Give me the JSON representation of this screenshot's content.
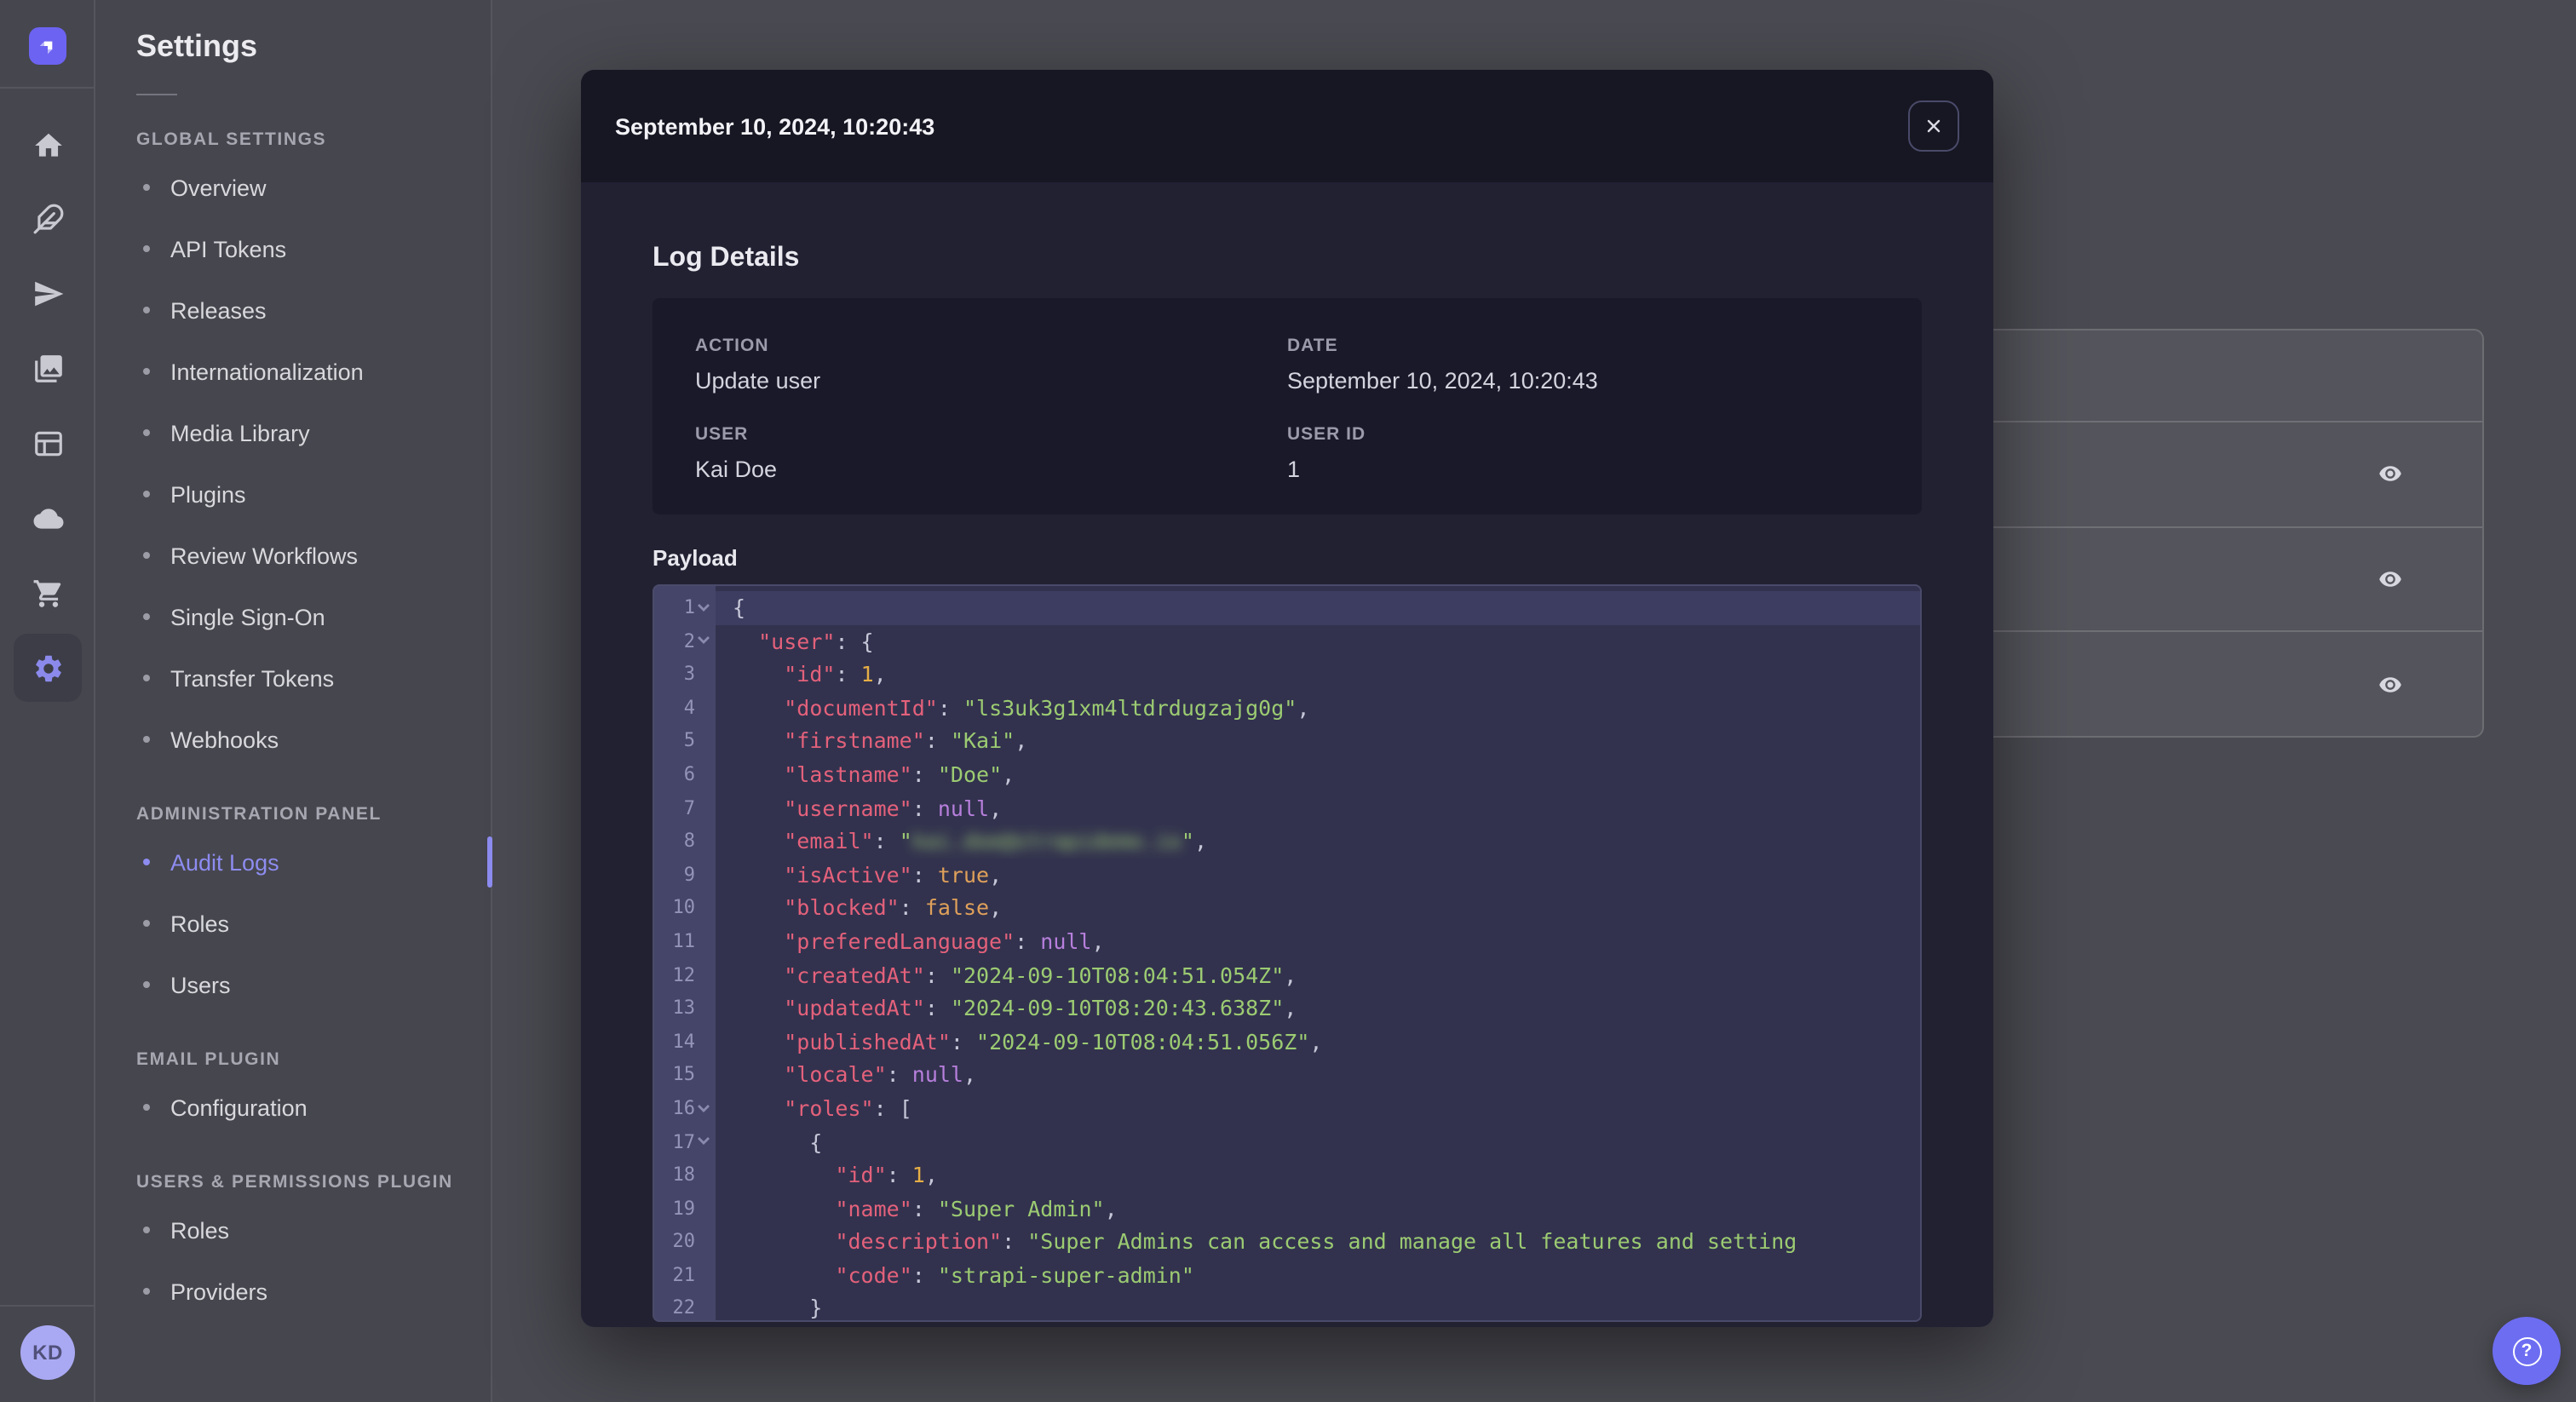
{
  "colors": {
    "brand": "#6c63f2",
    "nav_active": "#8d8cf0",
    "modal_bg": "#212132",
    "modal_header_bg": "#171723",
    "code_bg": "#32324e",
    "syntax_key": "#e4617b",
    "syntax_string": "#9ccb72",
    "syntax_number": "#e6ae45",
    "syntax_boolean": "#dfa05a",
    "syntax_null": "#b77fdc"
  },
  "rail": {
    "icons": [
      {
        "name": "home"
      },
      {
        "name": "feather"
      },
      {
        "name": "send"
      },
      {
        "name": "media"
      },
      {
        "name": "layout"
      },
      {
        "name": "cloud"
      },
      {
        "name": "cart"
      },
      {
        "name": "settings",
        "active": true
      }
    ],
    "avatar_initials": "KD"
  },
  "settings_nav": {
    "title": "Settings",
    "sections": [
      {
        "label": "GLOBAL SETTINGS",
        "items": [
          {
            "label": "Overview"
          },
          {
            "label": "API Tokens"
          },
          {
            "label": "Releases"
          },
          {
            "label": "Internationalization"
          },
          {
            "label": "Media Library"
          },
          {
            "label": "Plugins"
          },
          {
            "label": "Review Workflows"
          },
          {
            "label": "Single Sign-On"
          },
          {
            "label": "Transfer Tokens"
          },
          {
            "label": "Webhooks"
          }
        ]
      },
      {
        "label": "ADMINISTRATION PANEL",
        "items": [
          {
            "label": "Audit Logs",
            "active": true
          },
          {
            "label": "Roles"
          },
          {
            "label": "Users"
          }
        ]
      },
      {
        "label": "EMAIL PLUGIN",
        "items": [
          {
            "label": "Configuration"
          }
        ]
      },
      {
        "label": "USERS & PERMISSIONS PLUGIN",
        "items": [
          {
            "label": "Roles"
          },
          {
            "label": "Providers"
          }
        ]
      }
    ]
  },
  "background_table": {
    "rows": 3,
    "row_action_icon": "eye"
  },
  "help_fab": {
    "label": "?"
  },
  "modal": {
    "title": "September 10, 2024, 10:20:43",
    "close_icon": "x",
    "section_title": "Log Details",
    "details": [
      {
        "label": "ACTION",
        "value": "Update user"
      },
      {
        "label": "DATE",
        "value": "September 10, 2024, 10:20:43"
      },
      {
        "label": "USER",
        "value": "Kai Doe"
      },
      {
        "label": "USER ID",
        "value": "1"
      }
    ],
    "payload_label": "Payload",
    "code_lines": [
      {
        "n": 1,
        "fold": true,
        "active": true,
        "t": [
          [
            "p",
            "{"
          ]
        ]
      },
      {
        "n": 2,
        "fold": true,
        "t": [
          [
            "p",
            "  "
          ],
          [
            "k",
            "\"user\""
          ],
          [
            "p",
            ": {"
          ]
        ]
      },
      {
        "n": 3,
        "t": [
          [
            "p",
            "    "
          ],
          [
            "k",
            "\"id\""
          ],
          [
            "p",
            ": "
          ],
          [
            "n",
            "1"
          ],
          [
            "p",
            ","
          ]
        ]
      },
      {
        "n": 4,
        "t": [
          [
            "p",
            "    "
          ],
          [
            "k",
            "\"documentId\""
          ],
          [
            "p",
            ": "
          ],
          [
            "s",
            "\"ls3uk3g1xm4ltdrdugzajg0g\""
          ],
          [
            "p",
            ","
          ]
        ]
      },
      {
        "n": 5,
        "t": [
          [
            "p",
            "    "
          ],
          [
            "k",
            "\"firstname\""
          ],
          [
            "p",
            ": "
          ],
          [
            "s",
            "\"Kai\""
          ],
          [
            "p",
            ","
          ]
        ]
      },
      {
        "n": 6,
        "t": [
          [
            "p",
            "    "
          ],
          [
            "k",
            "\"lastname\""
          ],
          [
            "p",
            ": "
          ],
          [
            "s",
            "\"Doe\""
          ],
          [
            "p",
            ","
          ]
        ]
      },
      {
        "n": 7,
        "t": [
          [
            "p",
            "    "
          ],
          [
            "k",
            "\"username\""
          ],
          [
            "p",
            ": "
          ],
          [
            "u",
            "null"
          ],
          [
            "p",
            ","
          ]
        ]
      },
      {
        "n": 8,
        "t": [
          [
            "p",
            "    "
          ],
          [
            "k",
            "\"email\""
          ],
          [
            "p",
            ": "
          ],
          [
            "s",
            "\""
          ],
          [
            "e",
            "kai.doe@strapidemo.io"
          ],
          [
            "s",
            "\""
          ],
          [
            "p",
            ","
          ]
        ]
      },
      {
        "n": 9,
        "t": [
          [
            "p",
            "    "
          ],
          [
            "k",
            "\"isActive\""
          ],
          [
            "p",
            ": "
          ],
          [
            "b",
            "true"
          ],
          [
            "p",
            ","
          ]
        ]
      },
      {
        "n": 10,
        "t": [
          [
            "p",
            "    "
          ],
          [
            "k",
            "\"blocked\""
          ],
          [
            "p",
            ": "
          ],
          [
            "b",
            "false"
          ],
          [
            "p",
            ","
          ]
        ]
      },
      {
        "n": 11,
        "t": [
          [
            "p",
            "    "
          ],
          [
            "k",
            "\"preferedLanguage\""
          ],
          [
            "p",
            ": "
          ],
          [
            "u",
            "null"
          ],
          [
            "p",
            ","
          ]
        ]
      },
      {
        "n": 12,
        "t": [
          [
            "p",
            "    "
          ],
          [
            "k",
            "\"createdAt\""
          ],
          [
            "p",
            ": "
          ],
          [
            "s",
            "\"2024-09-10T08:04:51.054Z\""
          ],
          [
            "p",
            ","
          ]
        ]
      },
      {
        "n": 13,
        "t": [
          [
            "p",
            "    "
          ],
          [
            "k",
            "\"updatedAt\""
          ],
          [
            "p",
            ": "
          ],
          [
            "s",
            "\"2024-09-10T08:20:43.638Z\""
          ],
          [
            "p",
            ","
          ]
        ]
      },
      {
        "n": 14,
        "t": [
          [
            "p",
            "    "
          ],
          [
            "k",
            "\"publishedAt\""
          ],
          [
            "p",
            ": "
          ],
          [
            "s",
            "\"2024-09-10T08:04:51.056Z\""
          ],
          [
            "p",
            ","
          ]
        ]
      },
      {
        "n": 15,
        "t": [
          [
            "p",
            "    "
          ],
          [
            "k",
            "\"locale\""
          ],
          [
            "p",
            ": "
          ],
          [
            "u",
            "null"
          ],
          [
            "p",
            ","
          ]
        ]
      },
      {
        "n": 16,
        "fold": true,
        "t": [
          [
            "p",
            "    "
          ],
          [
            "k",
            "\"roles\""
          ],
          [
            "p",
            ": ["
          ]
        ]
      },
      {
        "n": 17,
        "fold": true,
        "t": [
          [
            "p",
            "      {"
          ]
        ]
      },
      {
        "n": 18,
        "t": [
          [
            "p",
            "        "
          ],
          [
            "k",
            "\"id\""
          ],
          [
            "p",
            ": "
          ],
          [
            "n",
            "1"
          ],
          [
            "p",
            ","
          ]
        ]
      },
      {
        "n": 19,
        "t": [
          [
            "p",
            "        "
          ],
          [
            "k",
            "\"name\""
          ],
          [
            "p",
            ": "
          ],
          [
            "s",
            "\"Super Admin\""
          ],
          [
            "p",
            ","
          ]
        ]
      },
      {
        "n": 20,
        "t": [
          [
            "p",
            "        "
          ],
          [
            "k",
            "\"description\""
          ],
          [
            "p",
            ": "
          ],
          [
            "s",
            "\"Super Admins can access and manage all features and setting"
          ]
        ]
      },
      {
        "n": 21,
        "t": [
          [
            "p",
            "        "
          ],
          [
            "k",
            "\"code\""
          ],
          [
            "p",
            ": "
          ],
          [
            "s",
            "\"strapi-super-admin\""
          ]
        ]
      },
      {
        "n": 22,
        "t": [
          [
            "p",
            "      }"
          ]
        ]
      }
    ]
  }
}
